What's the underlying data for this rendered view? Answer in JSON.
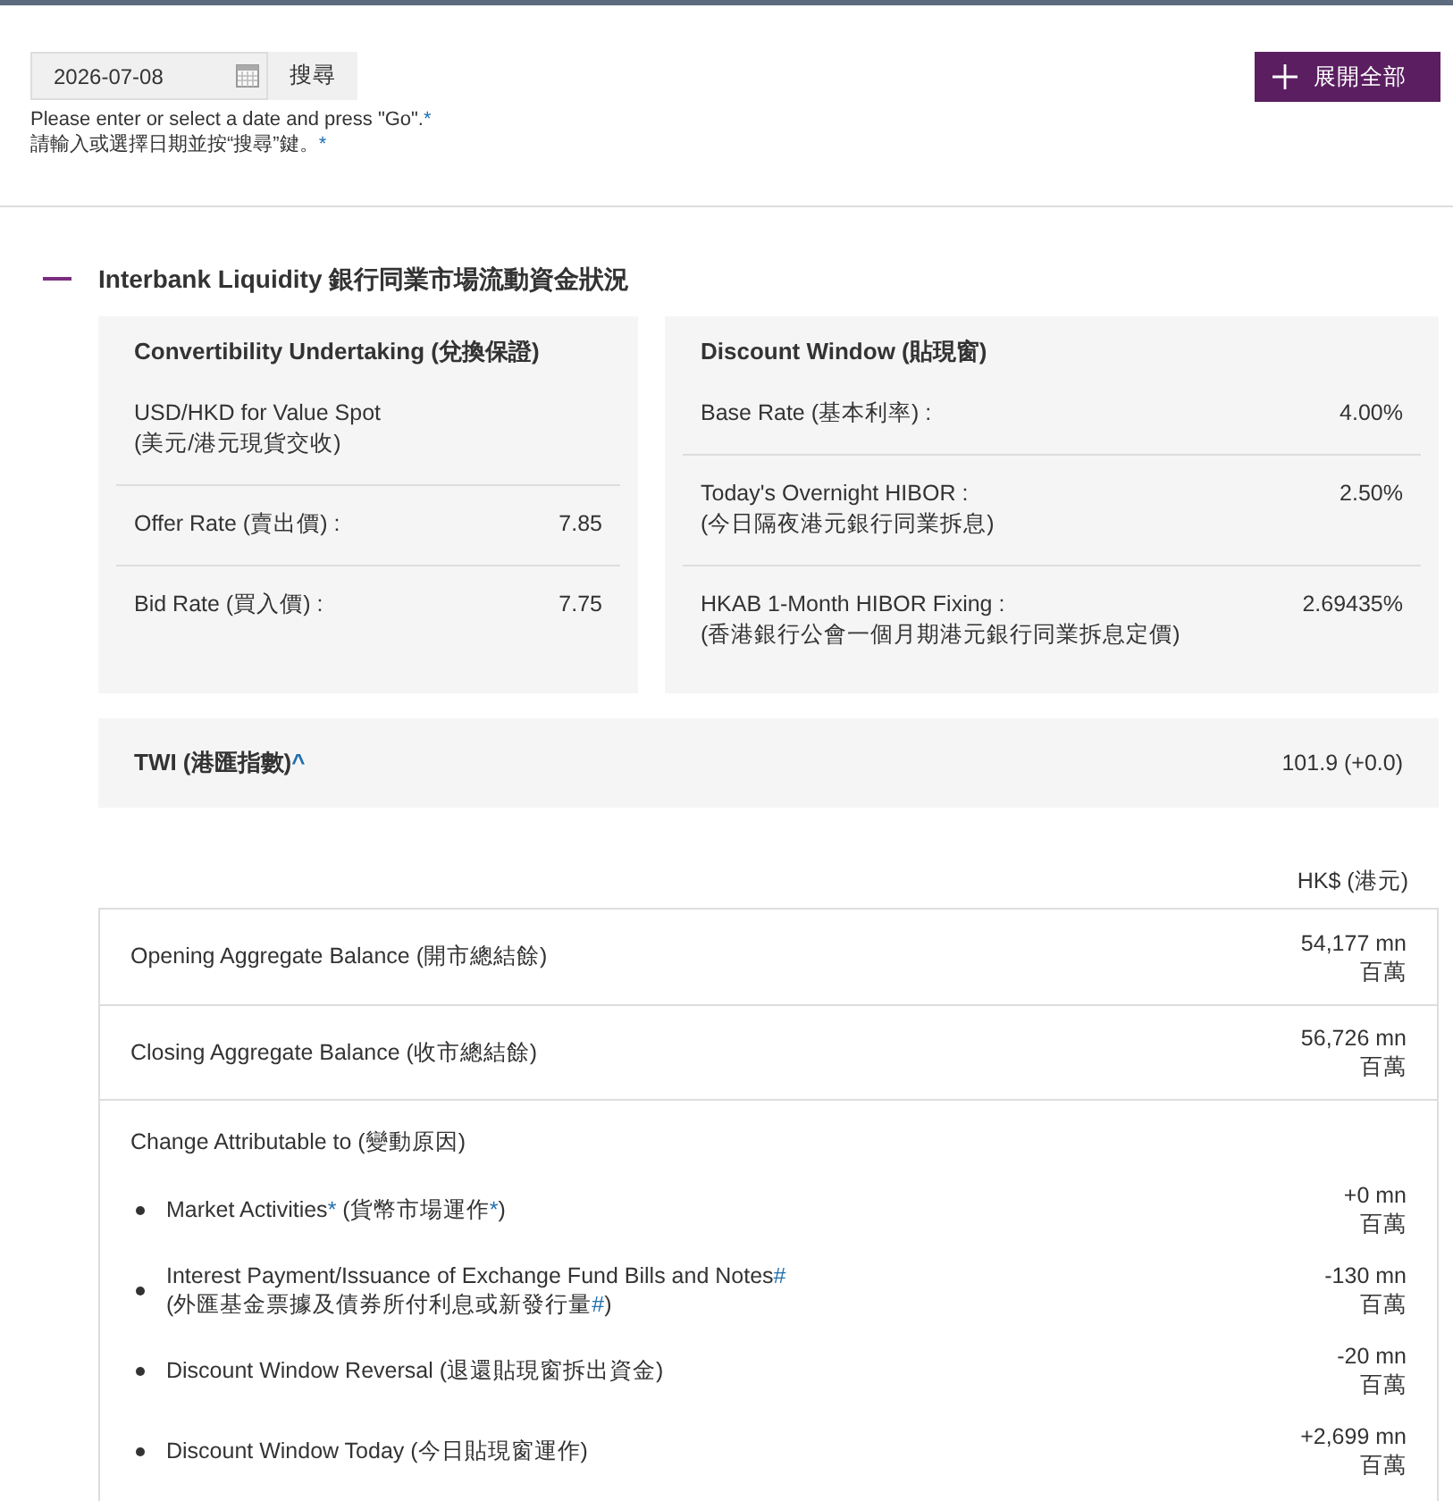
{
  "search": {
    "date": {
      "value": "2026-07-08"
    },
    "button": "搜尋",
    "hint_lines": [
      [
        {
          "kind": "text",
          "text": "Please enter or select a date and press \"Go\"."
        },
        {
          "kind": "link",
          "text": "*"
        }
      ],
      [
        {
          "kind": "text",
          "text": "請輸入或選擇日期並按“搜尋”鍵。"
        },
        {
          "kind": "link",
          "text": "*"
        }
      ]
    ]
  },
  "expand_all_button": "展開全部",
  "section": {
    "title": "Interbank Liquidity 銀行同業市場流動資金狀況",
    "expanded": true,
    "cards": [
      {
        "title": "Convertibility Undertaking (兌換保證)",
        "rows": [
          {
            "label_lines": [
              "USD/HKD for Value Spot",
              "(美元/港元現貨交收)"
            ]
          },
          {
            "label_lines": [
              "Offer Rate (賣出價) :"
            ],
            "value": "7.85"
          },
          {
            "label_lines": [
              "Bid Rate (買入價) :"
            ],
            "value": "7.75"
          }
        ]
      },
      {
        "title": "Discount Window (貼現窗)",
        "rows": [
          {
            "label_lines": [
              "Base Rate (基本利率) :"
            ],
            "value": "4.00%"
          },
          {
            "label_lines": [
              "Today's Overnight HIBOR :",
              "(今日隔夜港元銀行同業拆息)"
            ],
            "value": "2.50%"
          },
          {
            "label_lines": [
              "HKAB 1-Month HIBOR Fixing :",
              "(香港銀行公會一個月期港元銀行同業拆息定價)"
            ],
            "value": "2.69435%"
          }
        ]
      }
    ],
    "twi": {
      "label": [
        {
          "kind": "text",
          "text": "TWI (港匯指數)"
        },
        {
          "kind": "link",
          "text": "^"
        }
      ],
      "value": "101.9 (+0.0)"
    },
    "balance": {
      "currency": "HK$ (港元)",
      "rows": [
        {
          "label": "Opening Aggregate Balance (開市總結餘)",
          "amount": "54,177 mn",
          "unit": "百萬"
        },
        {
          "label": "Closing Aggregate Balance (收市總結餘)",
          "amount": "56,726 mn",
          "unit": "百萬"
        }
      ],
      "change": {
        "title": "Change Attributable to (變動原因)",
        "items": [
          {
            "label_lines": [
              [
                {
                  "kind": "text",
                  "text": "Market Activities"
                },
                {
                  "kind": "link",
                  "text": "*"
                },
                {
                  "kind": "text",
                  "text": " (貨幣市場運作"
                },
                {
                  "kind": "link",
                  "text": "*"
                },
                {
                  "kind": "text",
                  "text": ")"
                }
              ]
            ],
            "amount": "+0 mn",
            "unit": "百萬"
          },
          {
            "label_lines": [
              [
                {
                  "kind": "text",
                  "text": "Interest Payment/Issuance of Exchange Fund Bills and Notes"
                },
                {
                  "kind": "link",
                  "text": "#"
                }
              ],
              [
                {
                  "kind": "text",
                  "text": "(外匯基金票據及債券所付利息或新發行量"
                },
                {
                  "kind": "link",
                  "text": "#"
                },
                {
                  "kind": "text",
                  "text": ")"
                }
              ]
            ],
            "amount": "-130 mn",
            "unit": "百萬"
          },
          {
            "label_lines": [
              "Discount Window Reversal (退還貼現窗拆出資金)"
            ],
            "amount": "-20 mn",
            "unit": "百萬"
          },
          {
            "label_lines": [
              "Discount Window Today (今日貼現窗運作)"
            ],
            "amount": "+2,699 mn",
            "unit": "百萬"
          }
        ]
      }
    }
  }
}
